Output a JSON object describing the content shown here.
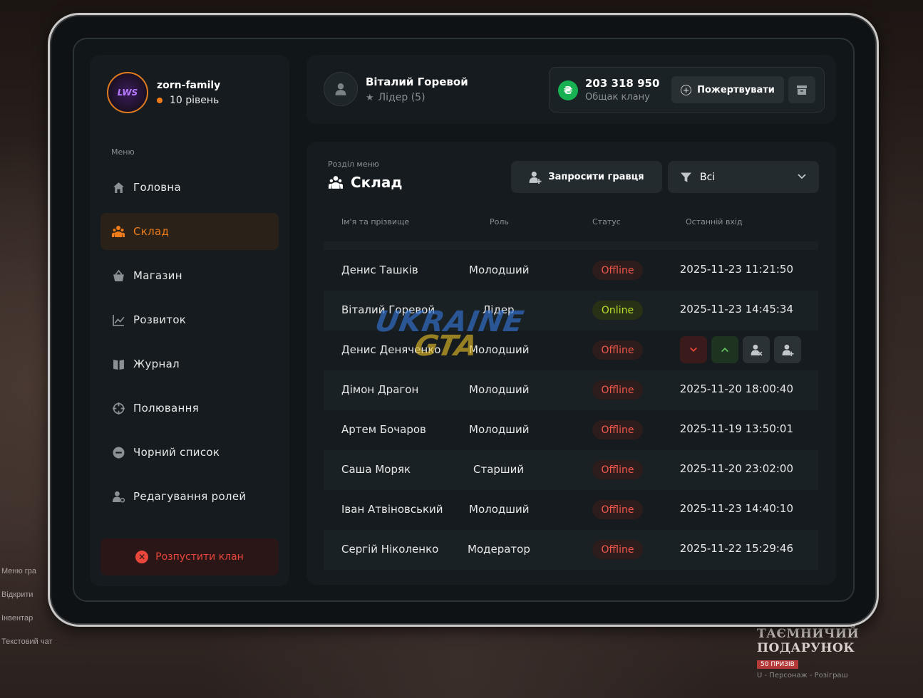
{
  "background": {
    "hud_lines": [
      "Меню гра",
      "Відкрити",
      "Інвентар",
      "Текстовий чат"
    ],
    "promo": {
      "title": "ТАЄМНИЧИЙ ПОДАРУНОК",
      "badge": "50 ПРИЗІВ",
      "hint": "Персонаж - Розіграш",
      "key": "U"
    }
  },
  "clan": {
    "name": "zorn-family",
    "level": "10 рівень",
    "avatar_text": "LWS"
  },
  "sidebar": {
    "caption": "Меню",
    "items": [
      {
        "label": "Головна",
        "icon": "home-icon",
        "active": false
      },
      {
        "label": "Склад",
        "icon": "members-icon",
        "active": true
      },
      {
        "label": "Магазин",
        "icon": "shop-icon",
        "active": false
      },
      {
        "label": "Розвиток",
        "icon": "chart-icon",
        "active": false
      },
      {
        "label": "Журнал",
        "icon": "book-icon",
        "active": false
      },
      {
        "label": "Полювання",
        "icon": "crosshair-icon",
        "active": false
      },
      {
        "label": "Чорний список",
        "icon": "minus-circle-icon",
        "active": false
      },
      {
        "label": "Редагування ролей",
        "icon": "user-gear-icon",
        "active": false
      }
    ],
    "disband_label": "Розпустити клан"
  },
  "user": {
    "name": "Віталий Горевой",
    "role": "Лідер (5)"
  },
  "bank": {
    "amount": "203 318 950",
    "label": "Общак клану",
    "currency_symbol": "₴",
    "donate_label": "Пожертвувати"
  },
  "section": {
    "caption": "Розділ меню",
    "title": "Склад",
    "invite_label": "Запросити гравця",
    "filter_value": "Всі"
  },
  "table": {
    "headers": {
      "name": "Ім'я та прізвище",
      "role": "Роль",
      "status": "Статус",
      "last": "Останній вхід"
    },
    "rows": [
      {
        "name": "Денис Ташків",
        "role": "Молодший",
        "status": "Offline",
        "last": "2025-11-23 11:21:50",
        "online": false,
        "actions": false
      },
      {
        "name": "Віталий Горевой",
        "role": "Лідер",
        "status": "Online",
        "last": "2025-11-23 14:45:34",
        "online": true,
        "actions": false
      },
      {
        "name": "Денис Деняченко",
        "role": "Молодший",
        "status": "Offline",
        "last": "",
        "online": false,
        "actions": true
      },
      {
        "name": "Дімон Драгон",
        "role": "Молодший",
        "status": "Offline",
        "last": "2025-11-20 18:00:40",
        "online": false,
        "actions": false
      },
      {
        "name": "Артем Бочаров",
        "role": "Молодший",
        "status": "Offline",
        "last": "2025-11-19 13:50:01",
        "online": false,
        "actions": false
      },
      {
        "name": "Саша Моряк",
        "role": "Старший",
        "status": "Offline",
        "last": "2025-11-20 23:02:00",
        "online": false,
        "actions": false
      },
      {
        "name": "Іван Атвіновський",
        "role": "Молодший",
        "status": "Offline",
        "last": "2025-11-23 14:40:10",
        "online": false,
        "actions": false
      },
      {
        "name": "Сергій Ніколенко",
        "role": "Модератор",
        "status": "Offline",
        "last": "2025-11-22 15:29:46",
        "online": false,
        "actions": false
      }
    ]
  },
  "watermark": {
    "line1": "UKRAINE",
    "line2": "GTA"
  },
  "colors": {
    "accent": "#f07c1a",
    "online": "#b8e02a",
    "offline": "#f0584c",
    "danger": "#e9463c",
    "coin": "#18b152"
  }
}
